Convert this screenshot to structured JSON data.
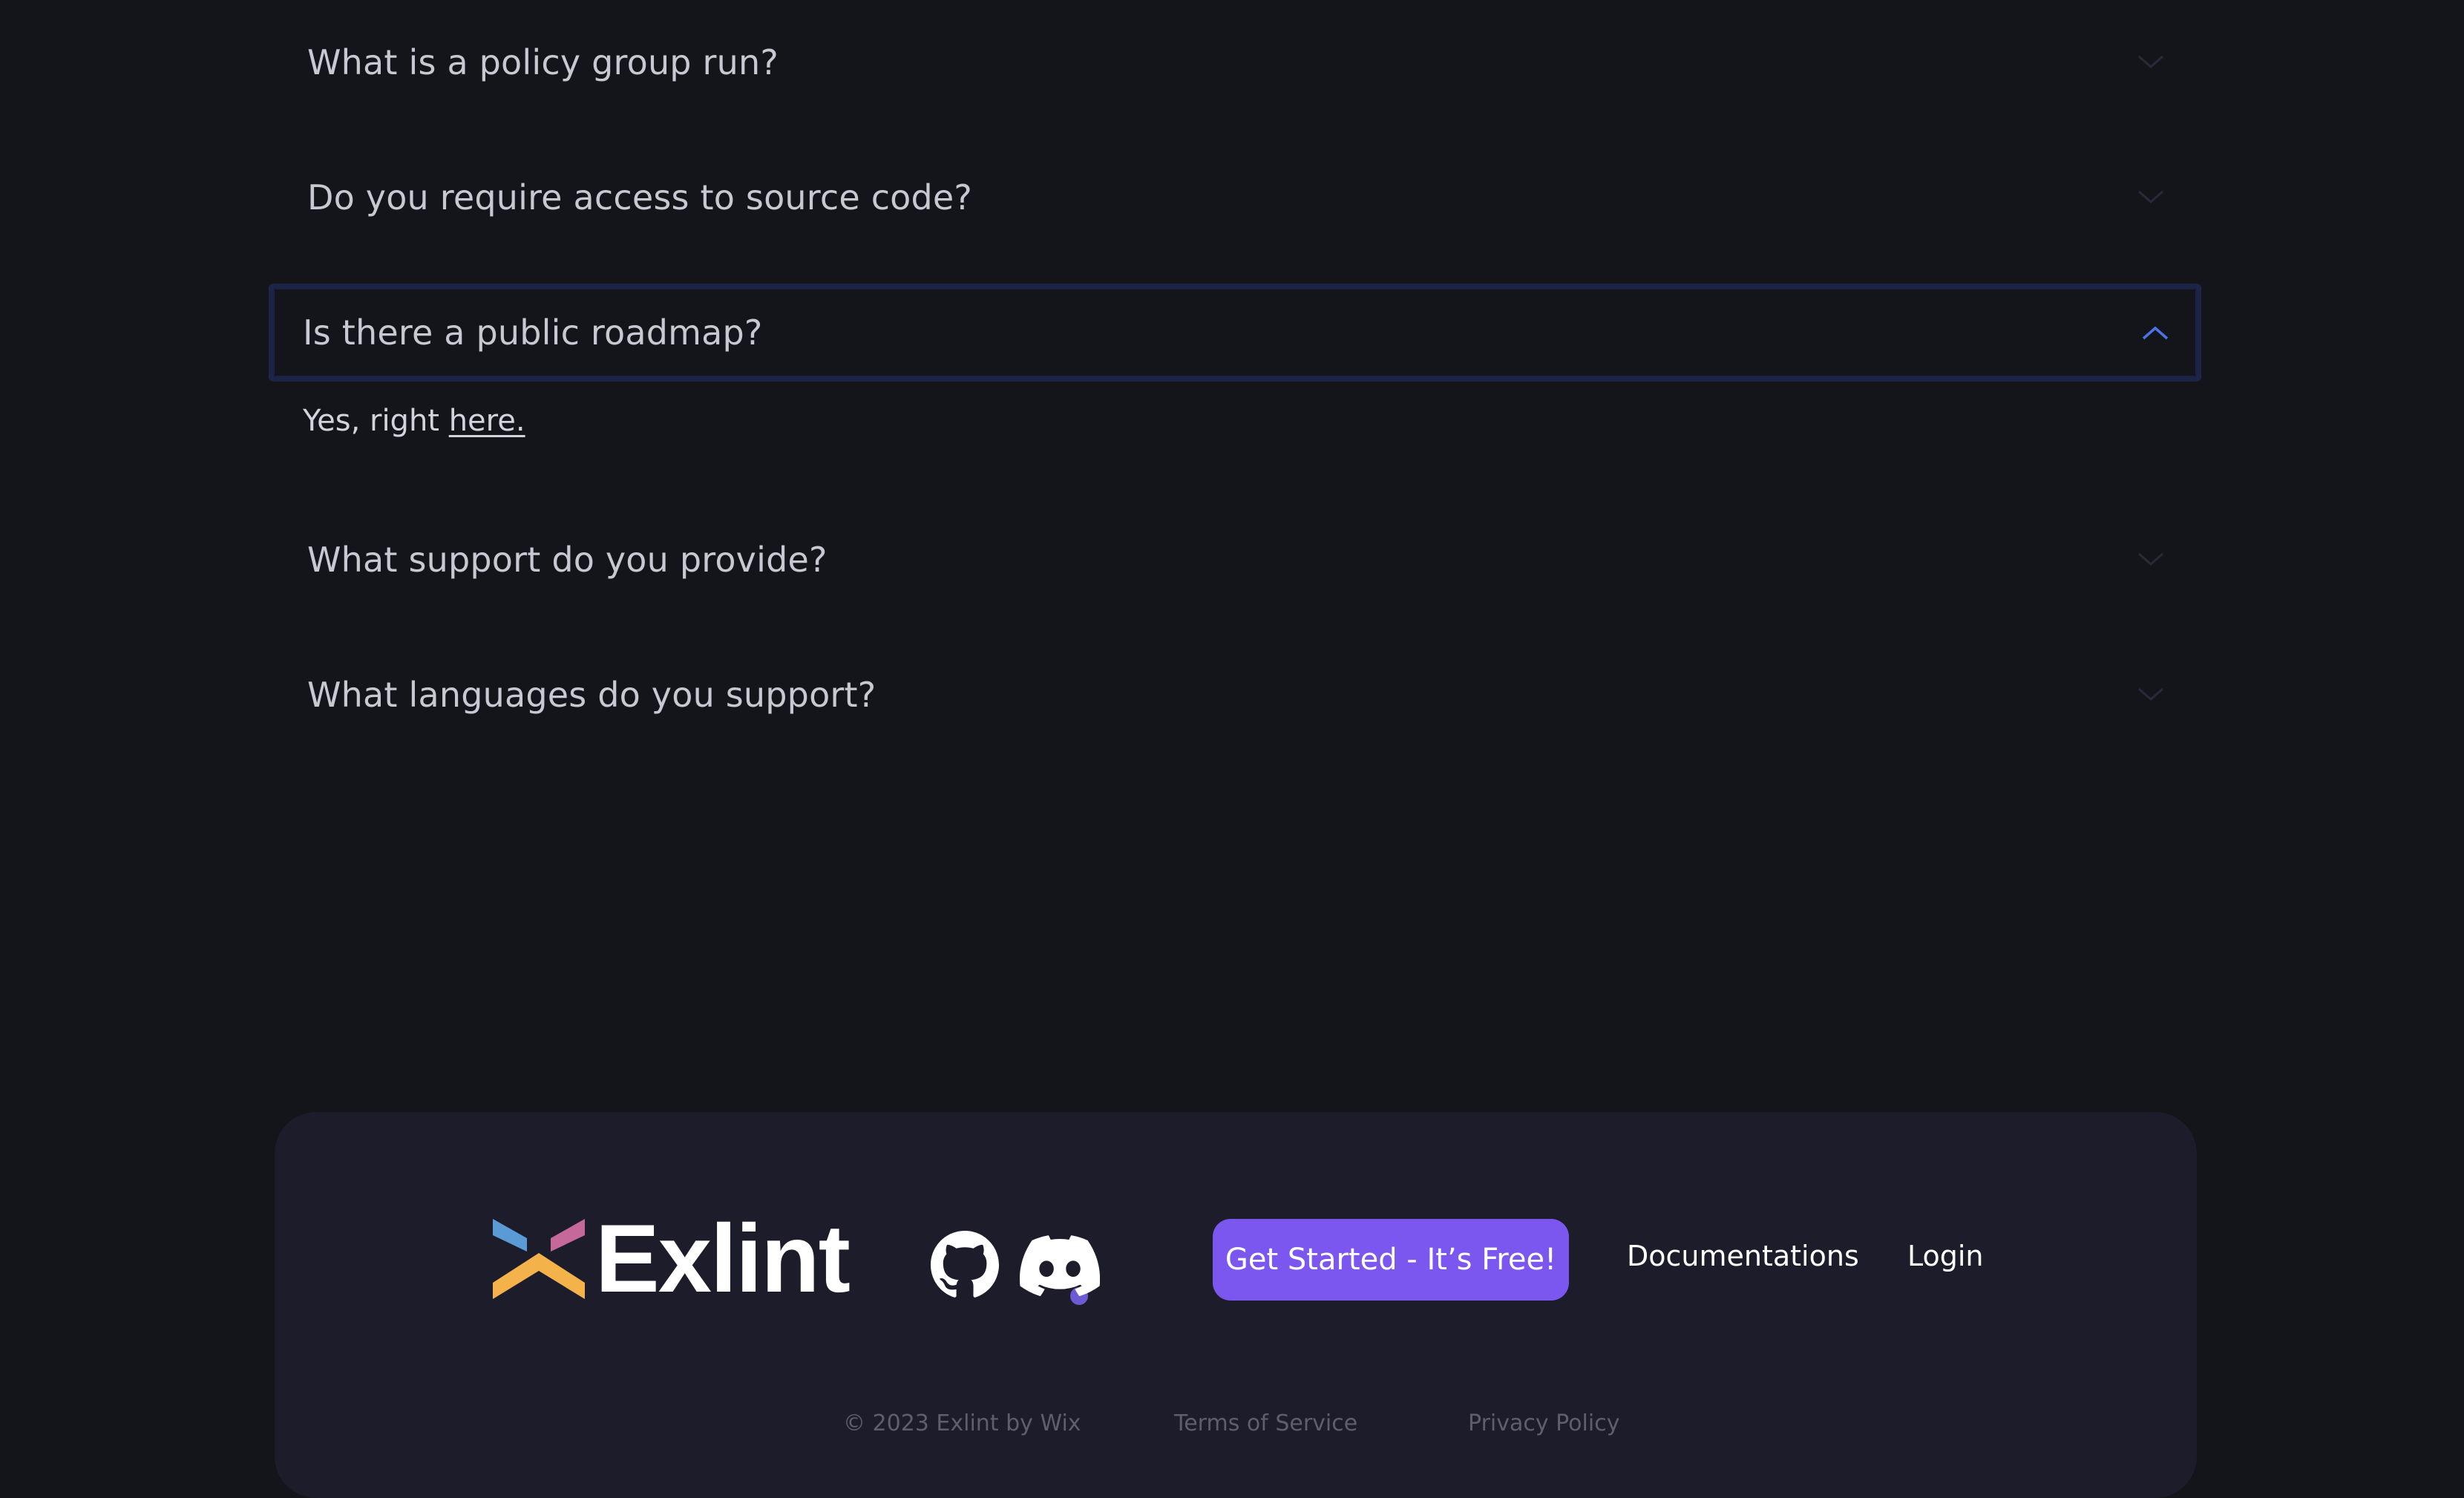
{
  "faq": {
    "items": [
      {
        "question": "What is a policy group run?",
        "expanded": false
      },
      {
        "question": "Do you require access to source code?",
        "expanded": false
      },
      {
        "question": "Is there a public roadmap?",
        "expanded": true,
        "answer_prefix": "Yes, right ",
        "answer_link": "here."
      },
      {
        "question": "What support do you provide?",
        "expanded": false
      },
      {
        "question": "What languages do you support?",
        "expanded": false
      }
    ],
    "icons": {
      "collapsed": "chevron-down-icon",
      "expanded": "chevron-up-icon"
    }
  },
  "footer": {
    "logo_text": "Exlint",
    "social": {
      "github": "github-icon",
      "discord": "discord-icon"
    },
    "cta_label": "Get Started - It’s Free!",
    "links": {
      "documentation": "Documentations",
      "login": "Login"
    },
    "bottom": {
      "copyright": "© 2023 Exlint by Wix",
      "terms": "Terms of Service",
      "privacy": "Privacy Policy"
    }
  },
  "colors": {
    "background": "#14141b",
    "footer_background": "#1d1c2a",
    "accent": "#7b57f0",
    "expanded_border": "#1c2547",
    "chevron_active": "#4a74e6",
    "logo_blue": "#5b9bd5",
    "logo_pink": "#c4699a",
    "logo_yellow": "#f4b24a"
  }
}
